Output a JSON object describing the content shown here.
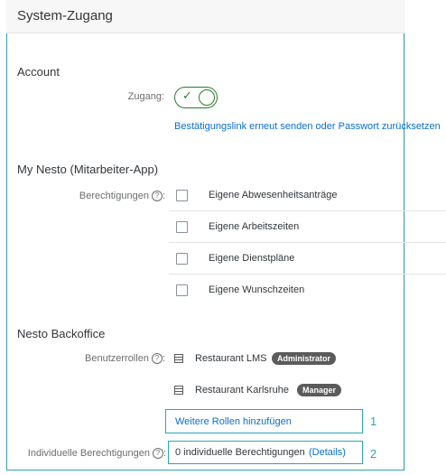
{
  "panel": {
    "title": "System-Zugang"
  },
  "account": {
    "section_title": "Account",
    "zugang_label": "Zugang:",
    "toggle_check": "✓",
    "resend_link": "Bestätigungslink erneut senden oder Passwort zurücksetzen"
  },
  "my_nesto": {
    "section_title": "My Nesto (Mitarbeiter-App)",
    "permissions_label": "Berechtigungen",
    "help_glyph": "?",
    "colon": ":",
    "permissions": [
      {
        "label": "Eigene Abwesenheitsanträge",
        "checked": false
      },
      {
        "label": "Eigene Arbeitszeiten",
        "checked": false
      },
      {
        "label": "Eigene Dienstpläne",
        "checked": false
      },
      {
        "label": "Eigene Wunschzeiten",
        "checked": false
      }
    ]
  },
  "backoffice": {
    "section_title": "Nesto Backoffice",
    "roles_label": "Benutzerrollen",
    "roles": [
      {
        "restaurant": "Restaurant LMS",
        "role": "Administrator"
      },
      {
        "restaurant": "Restaurant Karlsruhe",
        "role": "Manager"
      }
    ],
    "add_roles_link": "Weitere Rollen hinzufügen",
    "add_roles_marker": "1",
    "individual_label": "Individuelle Berechtigungen",
    "individual_value": "0 individuelle Berechtigungen",
    "details_link": "(Details)",
    "individual_marker": "2"
  },
  "colors": {
    "accent": "#2aa6b8",
    "toggle_on": "#2b7d2b",
    "link": "#0a6ed1",
    "badge": "#5b5b5b"
  }
}
